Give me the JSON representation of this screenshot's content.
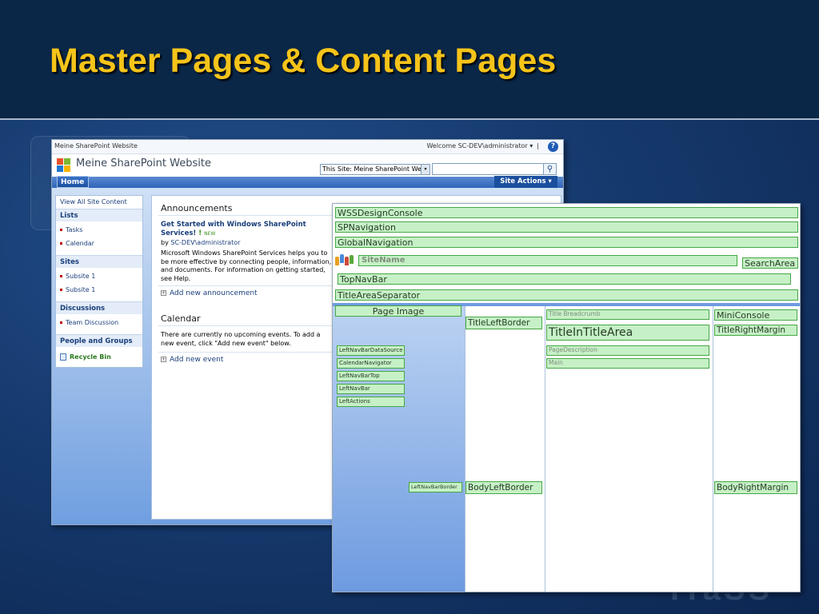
{
  "slide": {
    "title": "Master Pages & Content Pages",
    "watermark": "ITaSS"
  },
  "sharepoint": {
    "top_bar": {
      "site_crumb": "Meine SharePoint Website",
      "welcome": "Welcome SC-DEV\\administrator ▾",
      "separator": "|",
      "help_glyph": "?"
    },
    "site_title": "Meine SharePoint Website",
    "search": {
      "scope": "This Site: Meine SharePoint Website",
      "scope_arrow": "▾",
      "query": "",
      "button_glyph": "⚲"
    },
    "nav": {
      "home_tab": "Home",
      "site_actions": "Site Actions ▾"
    },
    "quick_launch": {
      "view_all": "View All Site Content",
      "lists_heading": "Lists",
      "lists": [
        "Tasks",
        "Calendar"
      ],
      "sites_heading": "Sites",
      "sites": [
        "Subsite 1",
        "Subsite 1"
      ],
      "discussions_heading": "Discussions",
      "discussions": [
        "Team Discussion"
      ],
      "people_heading": "People and Groups",
      "recycle_bin": "Recycle Bin"
    },
    "announcements": {
      "title": "Announcements",
      "item_title": "Get Started with Windows SharePoint Services!",
      "new_mark": "!",
      "new_badge": "NEW",
      "by_label": "by",
      "author": "SC-DEV\\administrator",
      "body": "Microsoft Windows SharePoint Services helps you to be more effective by connecting people, information, and documents. For information on getting started, see Help.",
      "add_link": "Add new announcement",
      "add_glyph": "+"
    },
    "calendar": {
      "title": "Calendar",
      "body": "There are currently no upcoming events. To add a new event, click \"Add new event\" below.",
      "add_link": "Add new event",
      "add_glyph": "+"
    },
    "colors": {
      "nav_blue": "#2f64b8",
      "link_blue": "#1a3f7a",
      "recycle_green": "#2b7a1f"
    }
  },
  "master_page": {
    "regions": {
      "wss_design_console": "WSSDesignConsole",
      "sp_navigation": "SPNavigation",
      "global_navigation": "GlobalNavigation",
      "site_name": "SiteName",
      "search_area": "SearchArea",
      "top_nav_bar": "TopNavBar",
      "title_area_separator": "TitleAreaSeparator",
      "page_image": "Page Image",
      "title_left_border": "TitleLeftBorder",
      "title_breadcrumb": "Title Breadcrumb",
      "title_in_title_area": "TitleInTitleArea",
      "mini_console": "MiniConsole",
      "title_right_margin": "TitleRightMargin",
      "page_description": "PageDescription",
      "main": "Main",
      "left_nav_bar_data_source": "LeftNavBarDataSource",
      "calendar_navigator": "CalendarNavigator",
      "left_nav_bar_top": "LeftNavBarTop",
      "left_nav_bar": "LeftNavBar",
      "left_actions": "LeftActions",
      "left_nav_bar_border": "LeftNavBarBorder",
      "body_left_border": "BodyLeftBorder",
      "body_right_margin": "BodyRightMargin"
    },
    "colors": {
      "placeholder_fill": "#c6f0c6",
      "placeholder_border": "#45a845"
    }
  }
}
